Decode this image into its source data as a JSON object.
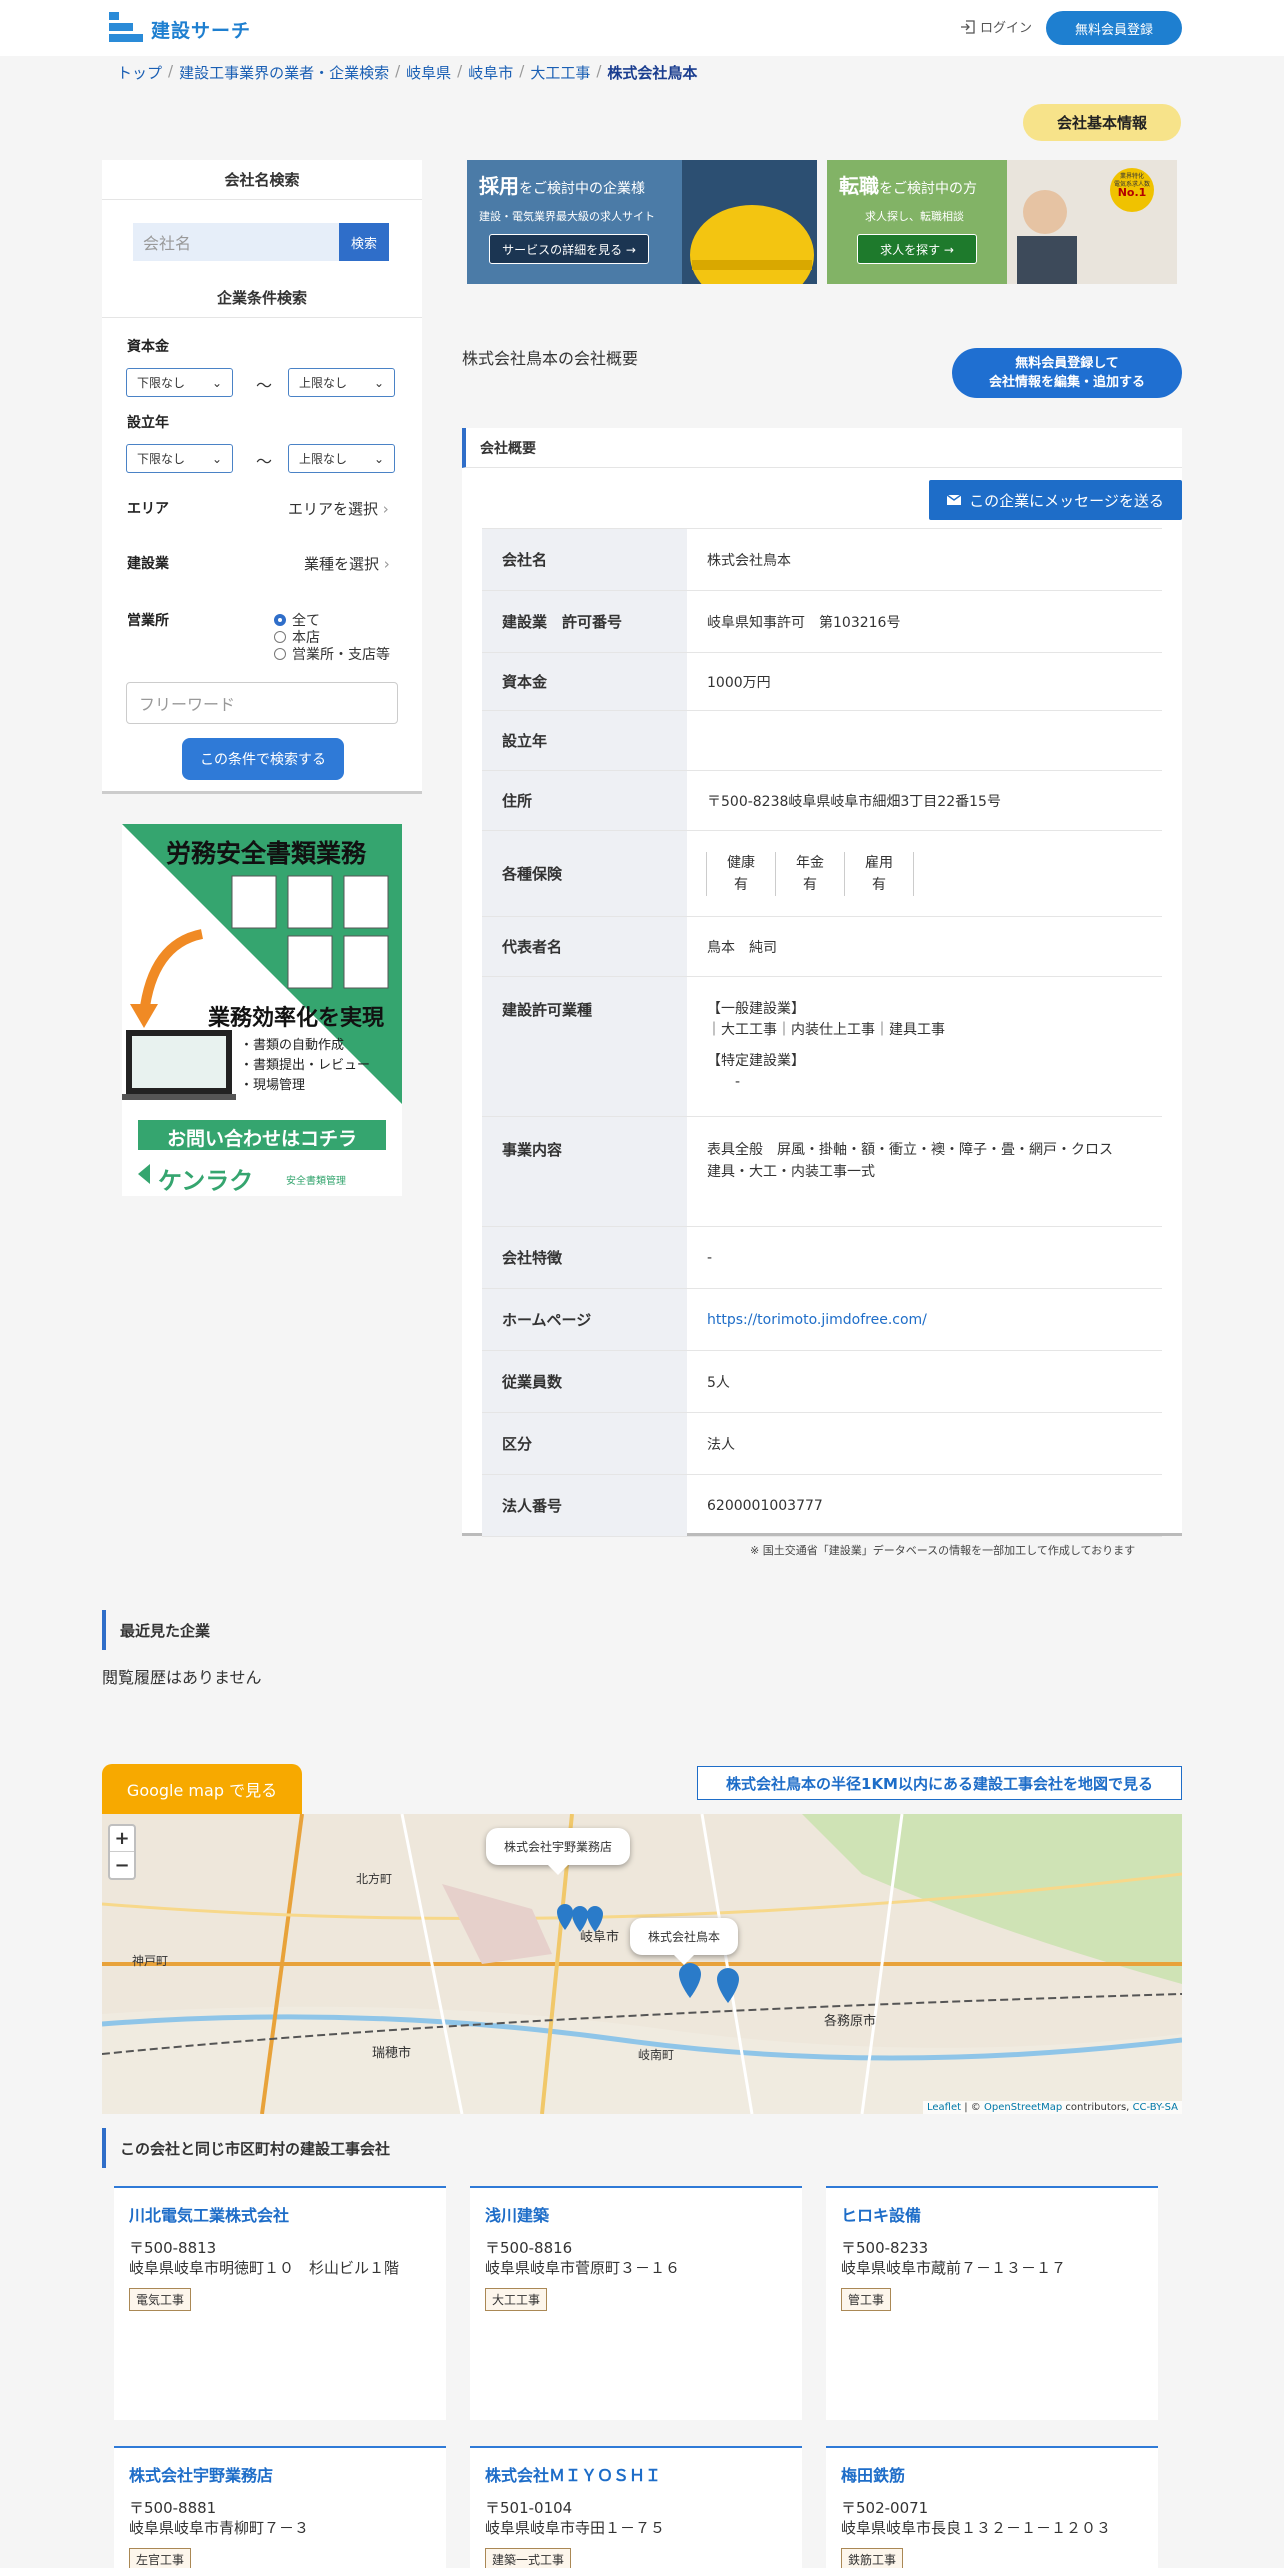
{
  "header": {
    "logo": "建設サーチ",
    "login": "ログイン",
    "register": "無料会員登録"
  },
  "breadcrumb": [
    "トップ",
    "建設工事業界の業者・企業検索",
    "岐阜県",
    "岐阜市",
    "大工工事",
    "株式会社鳥本"
  ],
  "badge": "会社基本情報",
  "sidebar": {
    "name_search_title": "会社名検索",
    "name_placeholder": "会社名",
    "name_button": "検索",
    "cond_title": "企業条件検索",
    "capital_label": "資本金",
    "lower": "下限なし",
    "upper": "上限なし",
    "tilde": "～",
    "founded_label": "設立年",
    "area_label": "エリア",
    "area_select": "エリアを選択",
    "industry_label": "建設業",
    "industry_select": "業種を選択",
    "office_label": "営業所",
    "office_options": [
      "全て",
      "本店",
      "営業所・支店等"
    ],
    "freeword_placeholder": "フリーワード",
    "submit": "この条件で検索する"
  },
  "ad": {
    "title": "労務安全書類業務",
    "headline": "業務効率化を実現",
    "bullets": [
      "・書類の自動作成",
      "・書類提出・レビュー",
      "・現場管理"
    ],
    "cta": "お問い合わせはコチラ",
    "brand": "ケンラク",
    "brand_sub": "安全書類管理"
  },
  "banners": {
    "hire": {
      "title_main": "採用",
      "title_rest": "をご検討中の企業様",
      "sub": "建設・電気業界最大級の求人サイト",
      "button": "サービスの詳細を見る →"
    },
    "job": {
      "title_main": "転職",
      "title_rest": "をご検討中の方",
      "sub": "求人探し、転職相談",
      "button": "求人を探す →",
      "badge_top": "業界特化",
      "badge_mid": "電気系求人数",
      "badge_no": "No.1"
    }
  },
  "intro": "株式会社鳥本の会社概要",
  "edit_button": [
    "無料会員登録して",
    "会社情報を編集・追加する"
  ],
  "card": {
    "title": "会社概要",
    "message_button": "この企業にメッセージを送る",
    "rows": {
      "name": {
        "k": "会社名",
        "v": "株式会社鳥本"
      },
      "permit": {
        "k": "建設業　許可番号",
        "v": "岐阜県知事許可　第103216号"
      },
      "capital": {
        "k": "資本金",
        "v": "1000万円"
      },
      "founded": {
        "k": "設立年",
        "v": ""
      },
      "address": {
        "k": "住所",
        "v": "〒500-8238岐阜県岐阜市細畑3丁目22番15号"
      },
      "insurance": {
        "k": "各種保険",
        "items": [
          {
            "name": "健康",
            "val": "有"
          },
          {
            "name": "年金",
            "val": "有"
          },
          {
            "name": "雇用",
            "val": "有"
          }
        ]
      },
      "rep": {
        "k": "代表者名",
        "v": "鳥本　純司"
      },
      "permit_types": {
        "k": "建設許可業種",
        "general_h": "【一般建設業】",
        "general_v": "｜大工工事｜内装仕上工事｜建具工事",
        "special_h": "【特定建設業】",
        "special_v": "-"
      },
      "business": {
        "k": "事業内容",
        "v1": "表具全般　屏風・掛軸・額・衝立・襖・障子・畳・網戸・クロス",
        "v2": "建具・大工・内装工事一式"
      },
      "feature": {
        "k": "会社特徴",
        "v": "-"
      },
      "homepage": {
        "k": "ホームページ",
        "v": "https://torimoto.jimdofree.com/"
      },
      "employees": {
        "k": "従業員数",
        "v": "5人"
      },
      "category": {
        "k": "区分",
        "v": "法人"
      },
      "corp_no": {
        "k": "法人番号",
        "v": "6200001003777"
      }
    }
  },
  "note": "※ 国土交通省「建設業」データベースの情報を一部加工して作成しております",
  "recent": {
    "title": "最近見た企業",
    "empty": "閲覧履歴はありません"
  },
  "map": {
    "google_button": "Google map で見る",
    "nearby_link": "株式会社鳥本の半径1KM以内にある建設工事会社を地図で見る",
    "popup1": "株式会社宇野業務店",
    "popup2": "株式会社鳥本",
    "places": [
      "北方町",
      "岐阜市",
      "神戸町",
      "瑞穂市",
      "岐南町",
      "各務原市"
    ],
    "attribution_a": "Leaflet",
    "attribution_b": "| ©",
    "attribution_c": "OpenStreetMap",
    "attribution_d": "contributors,",
    "attribution_e": "CC-BY-SA"
  },
  "same_city": {
    "title": "この会社と同じ市区町村の建設工事会社",
    "companies": [
      {
        "name": "川北電気工業株式会社",
        "zip": "〒500-8813",
        "addr": "岐阜県岐阜市明徳町１０　杉山ビル１階",
        "tag": "電気工事"
      },
      {
        "name": "浅川建築",
        "zip": "〒500-8816",
        "addr": "岐阜県岐阜市菅原町３－１６",
        "tag": "大工工事"
      },
      {
        "name": "ヒロキ設備",
        "zip": "〒500-8233",
        "addr": "岐阜県岐阜市蔵前７－１３－１７",
        "tag": "管工事"
      },
      {
        "name": "株式会社宇野業務店",
        "zip": "〒500-8881",
        "addr": "岐阜県岐阜市青柳町７－３",
        "tag": "左官工事"
      },
      {
        "name": "株式会社ＭＩＹＯＳＨＩ",
        "zip": "〒501-0104",
        "addr": "岐阜県岐阜市寺田１－７５",
        "tag": "建築一式工事"
      },
      {
        "name": "梅田鉄筋",
        "zip": "〒502-0071",
        "addr": "岐阜県岐阜市長良１３２－１－１２０３",
        "tag": "鉄筋工事"
      }
    ]
  }
}
